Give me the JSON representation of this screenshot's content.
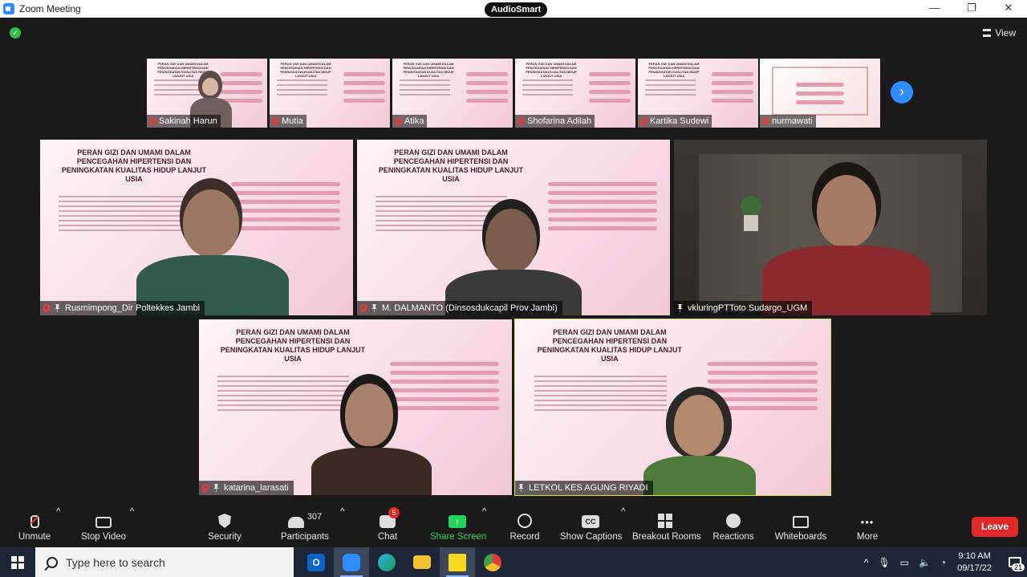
{
  "window": {
    "title": "Zoom Meeting",
    "audiosmart": "AudioSmart",
    "minimize": "—",
    "maximize": "❐",
    "close": "✕"
  },
  "meeting": {
    "view_label": "View",
    "next_page": "›"
  },
  "thumbnails": [
    {
      "name": "Sakinah Harun"
    },
    {
      "name": "Mutia"
    },
    {
      "name": "Atika"
    },
    {
      "name": "Shofarina Adilah"
    },
    {
      "name": "Kartika Sudewi"
    },
    {
      "name": "nurmawati"
    }
  ],
  "slide_text": {
    "title": "PERAN GIZI DAN UMAMI DALAM PENCEGAHAN HIPERTENSI DAN PENINGKATAN KUALITAS HIDUP LANJUT USIA"
  },
  "tiles": [
    {
      "name": "Rusmimpong_Dir Poltekkes Jambi"
    },
    {
      "name": "M. DALMANTO (Dinsosdukcapil Prov Jambi)"
    },
    {
      "name": "vkluringPTToto Sudargo_UGM"
    },
    {
      "name": "katarina_larasati"
    },
    {
      "name": "LETKOL KES AGUNG RIYADI"
    }
  ],
  "toolbar": {
    "unmute": "Unmute",
    "stop_video": "Stop Video",
    "security": "Security",
    "participants": "Participants",
    "participants_count": "307",
    "chat": "Chat",
    "chat_badge": "5",
    "share_screen": "Share Screen",
    "record": "Record",
    "show_captions": "Show Captions",
    "breakout_rooms": "Breakout Rooms",
    "reactions": "Reactions",
    "whiteboards": "Whiteboards",
    "more": "More",
    "leave": "Leave",
    "caret": "^",
    "cc": "CC",
    "more_dots": "•••"
  },
  "taskbar": {
    "search_placeholder": "Type here to search",
    "time": "9:10 AM",
    "date": "09/17/22",
    "notification_count": "21",
    "tray_up": "^"
  },
  "colors": {
    "accent": "#2d8cff",
    "leave": "#e02828",
    "share": "#24d35a",
    "speaking": "#d6e64a"
  }
}
